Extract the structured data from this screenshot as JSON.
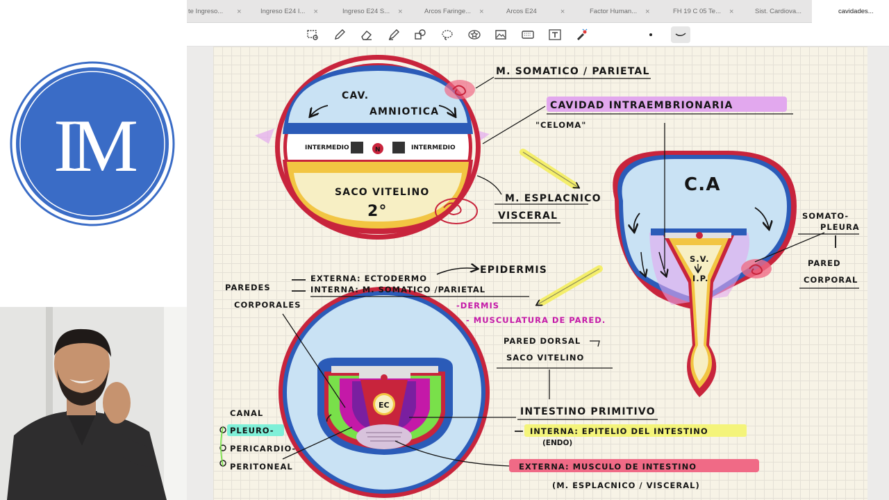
{
  "logo": {
    "text": "IM"
  },
  "tabs": [
    {
      "label": "te Ingreso..."
    },
    {
      "label": "Ingreso E24 I..."
    },
    {
      "label": "Ingreso E24 S..."
    },
    {
      "label": "Arcos Faringe..."
    },
    {
      "label": "Arcos E24"
    },
    {
      "label": "Factor Human..."
    },
    {
      "label": "FH 19 C 05 Te..."
    },
    {
      "label": "Sist. Cardiova..."
    },
    {
      "label": "cavidades..."
    }
  ],
  "tab_close_glyph": "×",
  "toolbar": {
    "tools": [
      "lasso-select-icon",
      "pen-icon",
      "eraser-icon",
      "highlighter-icon",
      "shapes-icon",
      "lasso-icon",
      "star-icon",
      "image-icon",
      "keyboard-icon",
      "text-icon",
      "laser-pointer-icon",
      "dot-icon",
      "curve-icon"
    ]
  },
  "notes": {
    "top_diagram": {
      "cav_amniotica_1": "CAV.",
      "cav_amniotica_2": "AMNIOTICA",
      "intermedio_left": "INTERMEDIO",
      "intermedio_right": "INTERMEDIO",
      "n_label": "N",
      "saco_vitelino_1": "SACO VITELINO",
      "saco_vitelino_2": "2°"
    },
    "m_somatico": "M. SOMATICO / PARIETAL",
    "cavidad_intra": "CAVIDAD INTRAEMBRIONARIA",
    "celoma": "\"CELOMA\"",
    "m_esplacnico": "M. ESPLACNICO",
    "visceral": "VISCERAL",
    "right_diagram": {
      "ca": "C.A",
      "sv": "S.V.",
      "ip": "I.P.",
      "somato_1": "SOMATO-",
      "somato_2": "PLEURA",
      "pared_1": "PARED",
      "pared_2": "CORPORAL"
    },
    "paredes_1": "PAREDES",
    "paredes_2": "CORPORALES",
    "externa_line": "EXTERNA: ECTODERMO",
    "epidermis": "EPIDERMIS",
    "interna_line": "INTERNA: M. SOMATICO /PARIETAL",
    "dermis": "-DERMIS",
    "musculatura": "- MUSCULATURA DE PARED.",
    "pared_dorsal_1": "PARED DORSAL",
    "pared_dorsal_2": "SACO VITELINO",
    "intestino": "INTESTINO PRIMITIVO",
    "interna_epitelio": "INTERNA: EPITELIO DEL INTESTINO",
    "endo": "(ENDO)",
    "externa_musculo": "EXTERNA: MUSCULO DE INTESTINO",
    "m_esplacnico_visceral": "(M. ESPLACNICO / VISCERAL)",
    "canal": "CANAL",
    "pleuro": "PLEURO-",
    "pericardio": "PERICARDIO-",
    "peritoneal": "PERITONEAL",
    "ec": "EC"
  },
  "colors": {
    "red": "#c8243c",
    "blue": "#2b5bb8",
    "light_blue": "#c9e2f4",
    "yellow": "#f2c542",
    "purple_highlight": "#e2a8ee",
    "green": "#79e04a",
    "magenta": "#c419a8",
    "pink_highlight": "#f06a86",
    "yellow_highlight": "#f4f47a",
    "cyan_highlight": "#7ff0d8",
    "logo_blue": "#3a6cc6"
  }
}
